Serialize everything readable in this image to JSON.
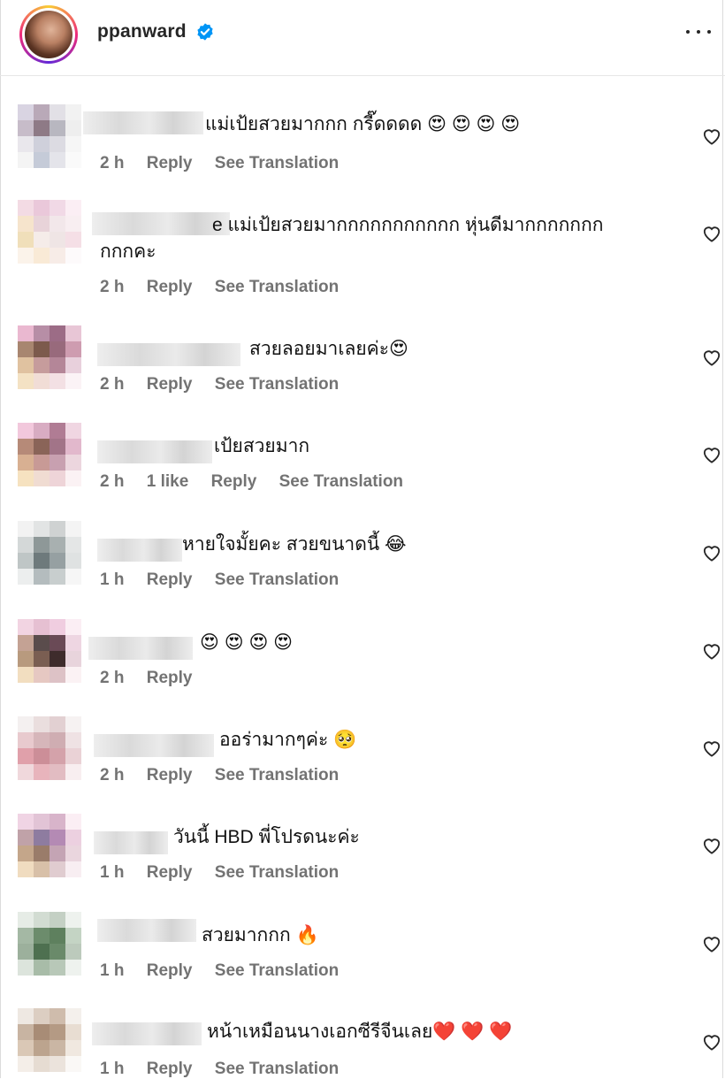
{
  "header": {
    "username": "ppanward"
  },
  "comments": [
    {
      "text": "แม่เป้ยสวยมากกก กรี๊ดดดด 😍 😍 😍 😍",
      "time": "2 h",
      "likes": "",
      "reply": "Reply",
      "translate": "See Translation"
    },
    {
      "text": "e แม่เป้ยสวยมากกกกกกกกกกก หุ่นดีมากกกกกกก",
      "text2": "กกกคะ",
      "time": "2 h",
      "likes": "",
      "reply": "Reply",
      "translate": "See Translation"
    },
    {
      "text": "สวยลอยมาเลยค่ะ😍",
      "time": "2 h",
      "likes": "",
      "reply": "Reply",
      "translate": "See Translation"
    },
    {
      "text": "เป้ยสวยมาก",
      "time": "2 h",
      "likes": "1 like",
      "reply": "Reply",
      "translate": "See Translation"
    },
    {
      "text": "หายใจมั้ยคะ สวยขนาดนี้ 😂",
      "time": "1 h",
      "likes": "",
      "reply": "Reply",
      "translate": "See Translation"
    },
    {
      "text": "😍 😍 😍 😍",
      "time": "2 h",
      "likes": "",
      "reply": "Reply",
      "translate": ""
    },
    {
      "text": "ออร่ามากๆค่ะ 🥺",
      "time": "2 h",
      "likes": "",
      "reply": "Reply",
      "translate": "See Translation"
    },
    {
      "text": "วันนี้ HBD พี่โปรดนะค่ะ",
      "time": "1 h",
      "likes": "",
      "reply": "Reply",
      "translate": "See Translation"
    },
    {
      "text": "สวยมากกก 🔥",
      "time": "1 h",
      "likes": "",
      "reply": "Reply",
      "translate": "See Translation"
    },
    {
      "text": "หน้าเหมือนนางเอกซีรีจีนเลย❤️ ❤️ ❤️",
      "time": "1 h",
      "likes": "",
      "reply": "Reply",
      "translate": "See Translation"
    }
  ],
  "colors": {
    "verified_blue": "#0095f6",
    "meta_gray": "#737373",
    "ring_gradient": [
      "#f9ce34",
      "#ee2a7b",
      "#6228d7"
    ]
  },
  "icons": [
    "verified-badge-icon",
    "more-options-icon",
    "heart-icon"
  ]
}
